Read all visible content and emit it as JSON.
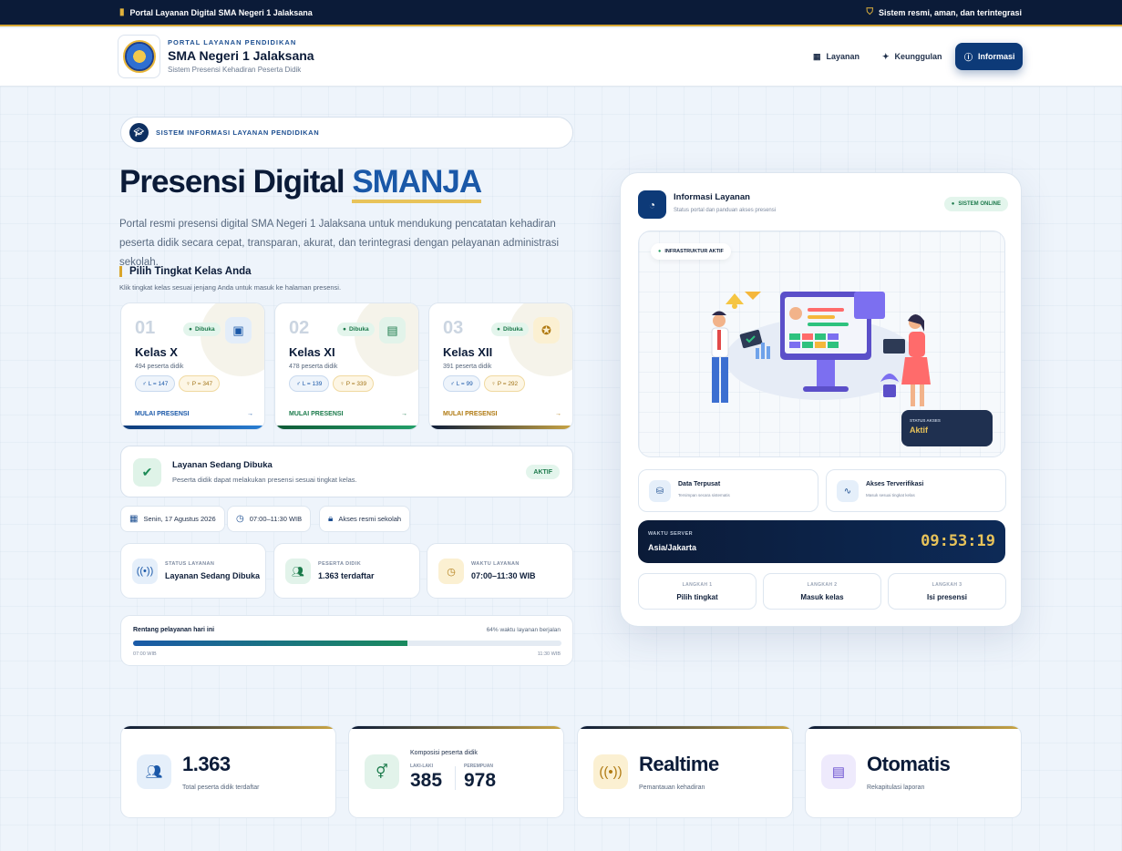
{
  "topbar": {
    "left": "Portal Layanan Digital SMA Negeri 1 Jalaksana",
    "right": "Sistem resmi, aman, dan terintegrasi"
  },
  "header": {
    "kicker": "PORTAL LAYANAN PENDIDIKAN",
    "title": "SMA Negeri 1 Jalaksana",
    "subtitle": "Sistem Presensi Kehadiran Peserta Didik"
  },
  "nav": [
    {
      "label": "Layanan",
      "icon": "grid-icon"
    },
    {
      "label": "Keunggulan",
      "icon": "sparkle-icon"
    },
    {
      "label": "Informasi",
      "icon": "info-icon",
      "active": true
    }
  ],
  "hero": {
    "pill": "SISTEM INFORMASI LAYANAN PENDIDIKAN",
    "title_a": "Presensi Digital ",
    "title_b": "SMANJA",
    "lead": "Portal resmi presensi digital SMA Negeri 1 Jalaksana untuk mendukung pencatatan kehadiran peserta didik secara cepat, transparan, akurat, dan terintegrasi dengan pelayanan administrasi sekolah.",
    "section_title": "Pilih Tingkat Kelas Anda",
    "section_sub": "Klik tingkat kelas sesuai jenjang Anda untuk masuk ke halaman presensi."
  },
  "classes": [
    {
      "num": "01",
      "badge": "Dibuka",
      "name": "Kelas X",
      "count": "494 peserta didik",
      "male": "L = 147",
      "female": "P = 347",
      "cta": "MULAI PRESENSI",
      "arrow": "→",
      "accent": "#1a58a8",
      "icon": "id-badge-icon"
    },
    {
      "num": "02",
      "badge": "Dibuka",
      "name": "Kelas XI",
      "count": "478 peserta didik",
      "male": "L = 139",
      "female": "P = 339",
      "cta": "MULAI PRESENSI",
      "arrow": "→",
      "accent": "#1a7a4a",
      "icon": "id-card-icon"
    },
    {
      "num": "03",
      "badge": "Dibuka",
      "name": "Kelas XII",
      "count": "391 peserta didik",
      "male": "L = 99",
      "female": "P = 292",
      "cta": "MULAI PRESENSI",
      "arrow": "→",
      "accent": "#b07a12",
      "icon": "award-icon"
    }
  ],
  "service": {
    "title": "Layanan Sedang Dibuka",
    "desc": "Peserta didik dapat melakukan presensi sesuai tingkat kelas.",
    "badge": "AKTIF"
  },
  "chips": [
    "Senin, 17 Agustus 2026",
    "07:00–11:30 WIB",
    "Akses resmi sekolah"
  ],
  "stats": [
    {
      "label": "STATUS LAYANAN",
      "value": "Layanan Sedang Dibuka",
      "icon": "signal-icon"
    },
    {
      "label": "PESERTA DIDIK",
      "value": "1.363 terdaftar",
      "icon": "users-icon"
    },
    {
      "label": "WAKTU LAYANAN",
      "value": "07:00–11:30 WIB",
      "icon": "clock-icon"
    }
  ],
  "range": {
    "title": "Rentang pelayanan hari ini",
    "progress_label": "64% waktu layanan berjalan",
    "progress": 0.64,
    "start": "07:00 WIB",
    "end": "11:30 WIB"
  },
  "panel": {
    "title": "Informasi Layanan",
    "subtitle": "Status portal dan panduan akses presensi",
    "online": "SISTEM ONLINE",
    "infra": "INFRASTRUKTUR AKTIF",
    "status_label": "STATUS AKSES",
    "status_value": "Aktif",
    "features": [
      {
        "title": "Data Terpusat",
        "desc": "Tersimpan secara sistematis",
        "icon": "database-icon"
      },
      {
        "title": "Akses Terverifikasi",
        "desc": "Masuk sesuai tingkat kelas",
        "icon": "pulse-icon"
      }
    ],
    "clock": {
      "label": "WAKTU SERVER",
      "zone": "Asia/Jakarta",
      "time": "09:53:19"
    },
    "steps": [
      {
        "label": "LANGKAH 1",
        "value": "Pilih tingkat"
      },
      {
        "label": "LANGKAH 2",
        "value": "Masuk kelas"
      },
      {
        "label": "LANGKAH 3",
        "value": "Isi presensi"
      }
    ]
  },
  "summary": [
    {
      "big": "1.363",
      "caption": "Total peserta didik terdaftar",
      "icon": "users-icon"
    },
    {
      "caption": "Komposisi peserta didik",
      "male_label": "LAKI-LAKI",
      "male": "385",
      "female_label": "PEREMPUAN",
      "female": "978",
      "icon": "gender-icon"
    },
    {
      "big": "Realtime",
      "caption": "Pemantauan kehadiran",
      "icon": "broadcast-icon"
    },
    {
      "big": "Otomatis",
      "caption": "Rekapitulasi laporan",
      "icon": "report-icon"
    }
  ]
}
